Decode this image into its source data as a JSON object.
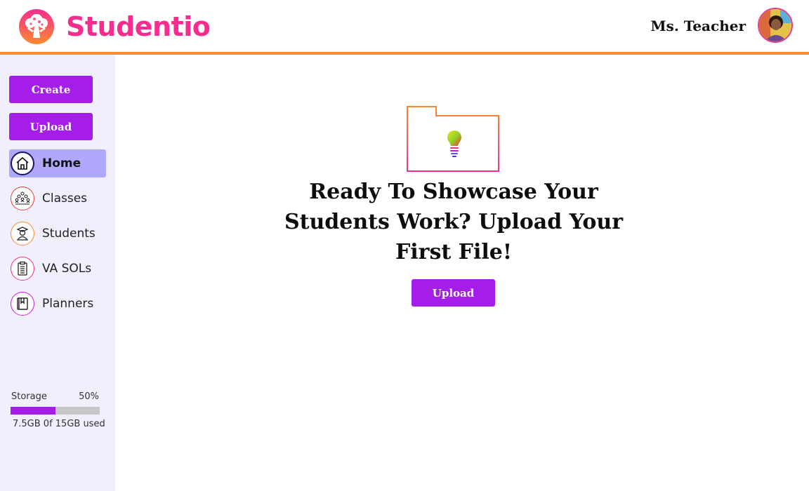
{
  "app": {
    "brand": "Studentio"
  },
  "header": {
    "user_name": "Ms. Teacher"
  },
  "sidebar": {
    "create_label": "Create",
    "upload_label": "Upload",
    "items": [
      {
        "label": "Home",
        "icon": "home-icon",
        "active": true
      },
      {
        "label": "Classes",
        "icon": "classes-icon"
      },
      {
        "label": "Students",
        "icon": "student-icon"
      },
      {
        "label": "VA SOLs",
        "icon": "clipboard-icon"
      },
      {
        "label": "Planners",
        "icon": "planner-icon"
      }
    ],
    "storage": {
      "label": "Storage",
      "percent_text": "50%",
      "percent": 50,
      "used_text": "7.5GB 0f 15GB used"
    }
  },
  "main": {
    "headline": "Ready To Showcase Your Students Work? Upload Your First File!",
    "upload_label": "Upload"
  },
  "colors": {
    "brand_pink": "#f72c8f",
    "accent_orange": "#f98a2e",
    "button_purple": "#a51de9",
    "active_nav": "#b0a9fb",
    "sidebar_bg": "#f1effc"
  }
}
